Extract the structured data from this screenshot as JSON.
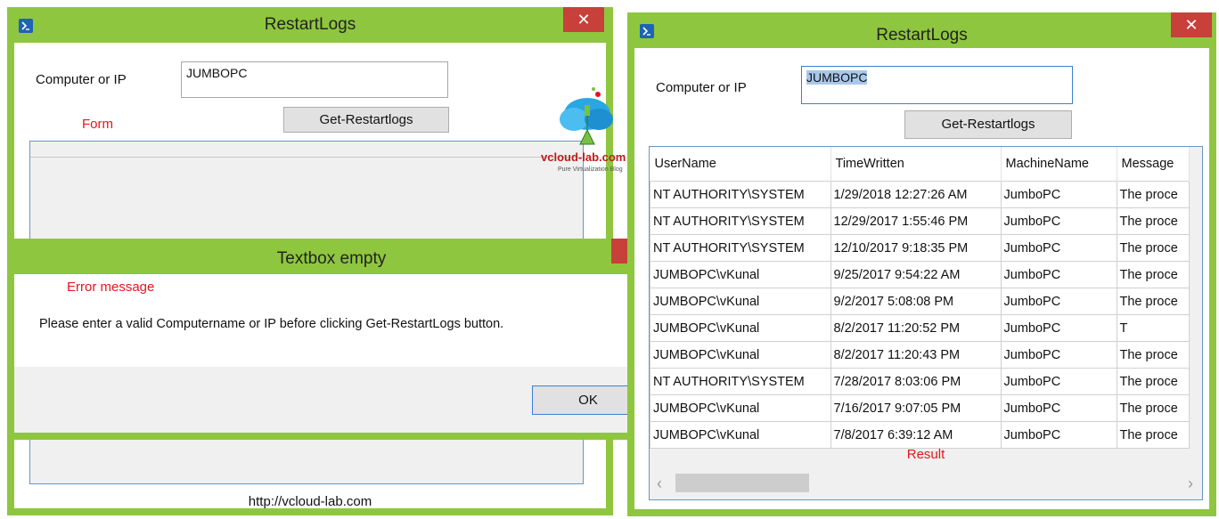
{
  "left_window": {
    "title": "RestartLogs",
    "close_glyph": "✕",
    "computer_label": "Computer or IP",
    "computer_value": "JUMBOPC",
    "button_label": "Get-Restartlogs",
    "form_note": "Form",
    "footer_link": "http://vcloud-lab.com"
  },
  "dialog": {
    "title": "Textbox empty",
    "close_glyph": "✕",
    "note": "Error message",
    "message": "Please enter a valid Computername or IP before clicking Get-RestartLogs button.",
    "ok_label": "OK"
  },
  "watermark": {
    "text": "vcloud-lab.com",
    "tagline": "Pure Virtualization Blog"
  },
  "right_window": {
    "title": "RestartLogs",
    "close_glyph": "✕",
    "computer_label": "Computer or IP",
    "computer_value": "JUMBOPC",
    "button_label": "Get-Restartlogs",
    "result_note": "Result",
    "grid": {
      "columns": [
        "UserName",
        "TimeWritten",
        "MachineName",
        "Message"
      ],
      "rows": [
        [
          "NT AUTHORITY\\SYSTEM",
          "1/29/2018 12:27:26 AM",
          "JumboPC",
          "The proce"
        ],
        [
          "NT AUTHORITY\\SYSTEM",
          "12/29/2017 1:55:46 PM",
          "JumboPC",
          "The proce"
        ],
        [
          "NT AUTHORITY\\SYSTEM",
          "12/10/2017 9:18:35 PM",
          "JumboPC",
          "The proce"
        ],
        [
          "JUMBOPC\\vKunal",
          "9/25/2017 9:54:22 AM",
          "JumboPC",
          "The proce"
        ],
        [
          "JUMBOPC\\vKunal",
          "9/2/2017 5:08:08 PM",
          "JumboPC",
          "The proce"
        ],
        [
          "JUMBOPC\\vKunal",
          "8/2/2017 11:20:52 PM",
          "JumboPC",
          "T"
        ],
        [
          "JUMBOPC\\vKunal",
          "8/2/2017 11:20:43 PM",
          "JumboPC",
          "The proce"
        ],
        [
          "NT AUTHORITY\\SYSTEM",
          "7/28/2017 8:03:06 PM",
          "JumboPC",
          "The proce"
        ],
        [
          "JUMBOPC\\vKunal",
          "7/16/2017 9:07:05 PM",
          "JumboPC",
          "The proce"
        ],
        [
          "JUMBOPC\\vKunal",
          "7/8/2017 6:39:12 AM",
          "JumboPC",
          "The proce"
        ]
      ]
    },
    "scroll_left_glyph": "‹",
    "scroll_right_glyph": "›"
  },
  "colors": {
    "window_frame": "#8ec63f",
    "close_button": "#c7403a",
    "annotation_red": "#e8141c",
    "selection": "#a8c8ea"
  }
}
